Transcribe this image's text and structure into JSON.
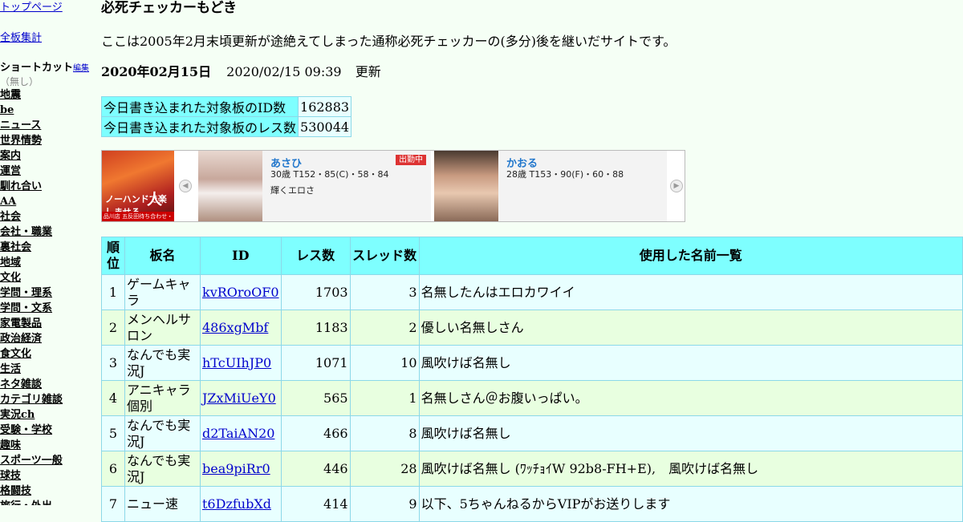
{
  "sidebar": {
    "top_link": "トップページ",
    "all_boards_link": "全板集計",
    "shortcut_label": "ショートカット",
    "shortcut_edit": "編集",
    "shortcut_none": "（無し）",
    "categories": [
      "地震",
      "be",
      "ニュース",
      "世界情勢",
      "案内",
      "運営",
      "馴れ合い",
      "AA",
      "社会",
      "会社・職業",
      "裏社会",
      "地域",
      "文化",
      "学問・理系",
      "学問・文系",
      "家電製品",
      "政治経済",
      "食文化",
      "生活",
      "ネタ雑談",
      "カテゴリ雑談",
      "実況ch",
      "受験・学校",
      "趣味",
      "スポーツ一般",
      "球技",
      "格闘技",
      "旅行・外出"
    ]
  },
  "main": {
    "title": "必死チェッカーもどき",
    "intro": "ここは2005年2月末頃更新が途絶えてしまった通称必死チェッカーの(多分)後を継いだサイトです。",
    "date": "2020年02月15日",
    "updated_time": "2020/02/15 09:39",
    "updated_label": "更新",
    "stats": [
      {
        "label": "今日書き込まれた対象板のID数",
        "value": "162883"
      },
      {
        "label": "今日書き込まれた対象板のレス数",
        "value": "530044"
      }
    ]
  },
  "ad": {
    "banner_text_small": "ノーハンドで楽しませる",
    "banner_text_big": "人妻",
    "banner_strip": "品川店 五反田待ち合わせ・出張",
    "cards": [
      {
        "name": "あさひ",
        "spec": "30歳 T152・85(C)・58・84",
        "catch": "輝くエロさ",
        "badge": "出勤中"
      },
      {
        "name": "かおる",
        "spec": "28歳 T153・90(F)・60・88",
        "catch": "",
        "badge": ""
      }
    ]
  },
  "ranking": {
    "headers": {
      "rank": "順位",
      "board": "板名",
      "id": "ID",
      "res": "レス数",
      "thread": "スレッド数",
      "names": "使用した名前一覧"
    },
    "rows": [
      {
        "rank": "1",
        "board": "ゲームキャラ",
        "id": "kvROroOF0",
        "res": "1703",
        "thread": "3",
        "names": "名無したんはエロカワイイ"
      },
      {
        "rank": "2",
        "board": "メンヘルサロン",
        "id": "486xgMbf",
        "res": "1183",
        "thread": "2",
        "names": "優しい名無しさん"
      },
      {
        "rank": "3",
        "board": "なんでも実況J",
        "id": "hTcUIhJP0",
        "res": "1071",
        "thread": "10",
        "names": "風吹けば名無し"
      },
      {
        "rank": "4",
        "board": "アニキャラ個別",
        "id": "JZxMiUeY0",
        "res": "565",
        "thread": "1",
        "names": "名無しさん＠お腹いっぱい。"
      },
      {
        "rank": "5",
        "board": "なんでも実況J",
        "id": "d2TaiAN20",
        "res": "466",
        "thread": "8",
        "names": "風吹けば名無し"
      },
      {
        "rank": "6",
        "board": "なんでも実況J",
        "id": "bea9piRr0",
        "res": "446",
        "thread": "28",
        "names": "風吹けば名無し (ﾜｯﾁｮｲW 92b8-FH+E),　風吹けば名無し"
      },
      {
        "rank": "7",
        "board": "ニュー速",
        "id": "t6DzfubXd",
        "res": "414",
        "thread": "9",
        "names": "以下、5ちゃんねるからVIPがお送りします"
      }
    ]
  }
}
